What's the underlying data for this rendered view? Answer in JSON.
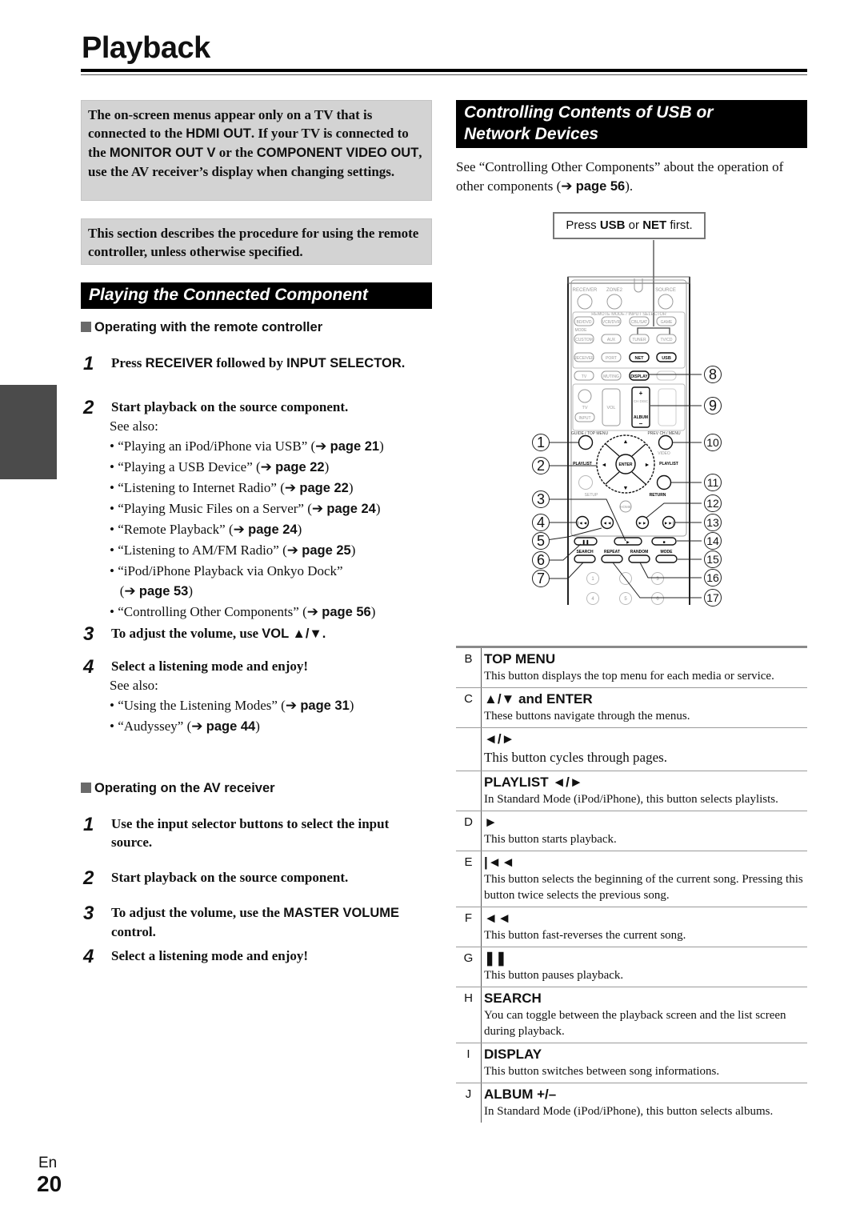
{
  "header": {
    "title": "Playback"
  },
  "left": {
    "note_hdmi": {
      "parts": [
        {
          "t": "The on-screen menus appear only on a TV that is connected to the ",
          "s": false
        },
        {
          "t": "HDMI OUT",
          "s": true
        },
        {
          "t": ". If your TV is connected to the ",
          "s": false
        },
        {
          "t": "MONITOR OUT V",
          "s": true
        },
        {
          "t": " or the ",
          "s": false
        },
        {
          "t": "COMPONENT VIDEO OUT",
          "s": true
        },
        {
          "t": ", use the AV receiver’s display when changing settings.",
          "s": false
        }
      ]
    },
    "note_remote": "This section describes the procedure for using the remote controller, unless otherwise specified.",
    "section_title": "Playing the Connected Component",
    "remote_subhead": "Operating with the remote controller",
    "remote_steps": {
      "s1": {
        "num": "1",
        "a": "Press ",
        "b": "RECEIVER",
        "c": " followed by ",
        "d": "INPUT SELECTOR."
      },
      "s2": {
        "num": "2",
        "text": "Start playback on the source component.",
        "see_also": "See also:"
      },
      "s2_bullets": [
        {
          "text": "• “Playing an iPod/iPhone via USB” (➔ ",
          "page": "page 21",
          "end": ")"
        },
        {
          "text": "• “Playing a USB Device” (➔ ",
          "page": "page 22",
          "end": ")"
        },
        {
          "text": "• “Listening to Internet Radio” (➔ ",
          "page": "page 22",
          "end": ")"
        },
        {
          "text": "• “Playing Music Files on a Server” (➔ ",
          "page": "page 24",
          "end": ")"
        },
        {
          "text": "• “Remote Playback” (➔ ",
          "page": "page 24",
          "end": ")"
        },
        {
          "text": "• “Listening to AM/FM Radio” (➔ ",
          "page": "page 25",
          "end": ")"
        },
        {
          "text": "• “iPod/iPhone Playback via Onkyo Dock”",
          "page": "",
          "end": ""
        },
        {
          "text": "   (➔ ",
          "page": "page 53",
          "end": ")"
        },
        {
          "text": "• “Controlling Other Components” (➔ ",
          "page": "page 56",
          "end": ")"
        }
      ],
      "s3": {
        "num": "3",
        "a": "To adjust the volume, use ",
        "b": "VOL ▲/▼."
      },
      "s4": {
        "num": "4",
        "text": "Select a listening mode and enjoy!",
        "see_also": "See also:"
      },
      "s4_bullets": [
        {
          "text": "• “Using the Listening Modes” (➔ ",
          "page": "page 31",
          "end": ")"
        },
        {
          "text": "• “Audyssey” (➔ ",
          "page": "page 44",
          "end": ")"
        }
      ]
    },
    "receiver_subhead": "Operating on the AV receiver",
    "receiver_steps": {
      "s1": {
        "num": "1",
        "text": "Use the input selector buttons to select the input source."
      },
      "s2": {
        "num": "2",
        "text": "Start playback on the source component."
      },
      "s3": {
        "num": "3",
        "a": "To adjust the volume, use the ",
        "b": "MASTER VOLUME",
        "c": " control."
      },
      "s4": {
        "num": "4",
        "text": "Select a listening mode and enjoy!"
      }
    }
  },
  "right": {
    "section_title_line1": "Controlling Contents of USB or",
    "section_title_line2": "Network Devices",
    "intro_text": "See “Controlling Other Components” about the operation of other components (➔ ",
    "intro_page": "page 56",
    "intro_end": ").",
    "press_box": {
      "a": "Press ",
      "b": "USB",
      "c": " or ",
      "d": "NET",
      "e": " first."
    },
    "remote": {
      "labels": {
        "receiver": "RECEIVER",
        "zone2": "ZONE2",
        "source": "SOURCE",
        "remote_mode": "REMOTE MODE / INPUT SELECTOR",
        "mode": "MODE",
        "bd_dvd": "BD/DVD",
        "vcr_dvr": "VCR/DVR",
        "cbl_sat": "CBL/SAT",
        "game": "GAME",
        "custom": "CUSTOM",
        "aux": "AUX",
        "tuner": "TUNER",
        "tv_cd": "TV/CD",
        "receiver_btn": "RECEIVER",
        "port": "PORT",
        "net": "NET",
        "usb": "USB",
        "tv": "TV",
        "muting": "MUTING",
        "display": "DISPLAY",
        "setup_small": "SETUP",
        "tv_label": "TV",
        "vol": "VOL",
        "input": "INPUT",
        "ch_disc": "CH DISC",
        "album": "ALBUM",
        "guide_top_menu": "GUIDE / TOP MENU",
        "prev_ch_menu": "PREV CH / MENU",
        "playlist_left": "PLAYLIST",
        "playlist_right": "PLAYLIST",
        "enter": "ENTER",
        "video": "VIDEO",
        "setup": "SETUP",
        "return": "RETURN",
        "home": "HOME",
        "search": "SEARCH",
        "repeat": "REPEAT",
        "random": "RANDOM",
        "mode_btn": "MODE",
        "n1": "1",
        "n3": "3",
        "n4": "4",
        "n5": "5",
        "n6": "6"
      },
      "callouts": [
        "1",
        "2",
        "3",
        "4",
        "5",
        "6",
        "7",
        "8",
        "9",
        "10",
        "11",
        "12",
        "13",
        "14",
        "15",
        "16",
        "17"
      ]
    },
    "table": [
      {
        "letter": "B",
        "title": "TOP MENU",
        "desc": "This button displays the top menu for each media or service."
      },
      {
        "letter": "C",
        "title": "▲/▼ and ENTER",
        "desc": "These buttons navigate through the menus."
      },
      {
        "letter": "",
        "title": "◄/►",
        "desc": "This button cycles through pages."
      },
      {
        "letter": "",
        "title": "PLAYLIST ◄/►",
        "desc": "In Standard Mode (iPod/iPhone), this button selects playlists."
      },
      {
        "letter": "D",
        "title": "►",
        "desc": "This button starts playback."
      },
      {
        "letter": "E",
        "title": "|◄◄",
        "desc": "This button selects the beginning of the current song. Pressing this button twice selects the previous song."
      },
      {
        "letter": "F",
        "title": "◄◄",
        "desc": "This button fast-reverses the current song."
      },
      {
        "letter": "G",
        "title": "❚❚",
        "desc": "This button pauses playback."
      },
      {
        "letter": "H",
        "title": "SEARCH",
        "desc": "You can toggle between the playback screen and the list screen during playback."
      },
      {
        "letter": "I",
        "title": "DISPLAY",
        "desc": "This button switches between song informations."
      },
      {
        "letter": "J",
        "title": "ALBUM +/–",
        "desc": "In Standard Mode (iPod/iPhone), this button selects albums."
      }
    ]
  },
  "footer": {
    "lang": "En",
    "page_number": "20"
  }
}
